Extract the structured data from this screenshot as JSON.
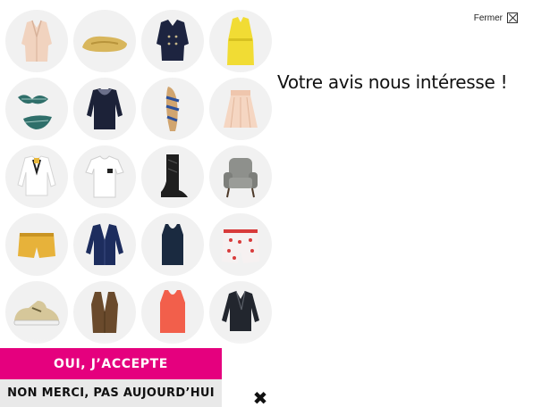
{
  "close": {
    "label": "Fermer",
    "icon": "close-box-icon"
  },
  "headline": "Votre avis nous intéresse !",
  "products": [
    "beige-blazer",
    "gold-ballerina-flat",
    "navy-peacoat",
    "yellow-trench-coat",
    "striped-bikini",
    "navy-lace-top",
    "blue-strappy-sandal",
    "blush-pleated-skirt",
    "white-bow-blouse",
    "white-tshirt",
    "black-boots",
    "grey-armchair",
    "yellow-shorts",
    "navy-cardigan",
    "navy-tank-top",
    "heart-print-shorts",
    "metallic-sneaker",
    "brown-leather-vest",
    "coral-tank-top",
    "black-leather-jacket"
  ],
  "buttons": {
    "accept": "OUI, J’ACCEPTE",
    "decline": "NON MERCI, PAS AUJOURD’HUI",
    "dismiss": "✖"
  },
  "colors": {
    "accent": "#e5007e",
    "decline_bg": "#e9e9e9",
    "circle_bg": "#f1f1f1"
  }
}
